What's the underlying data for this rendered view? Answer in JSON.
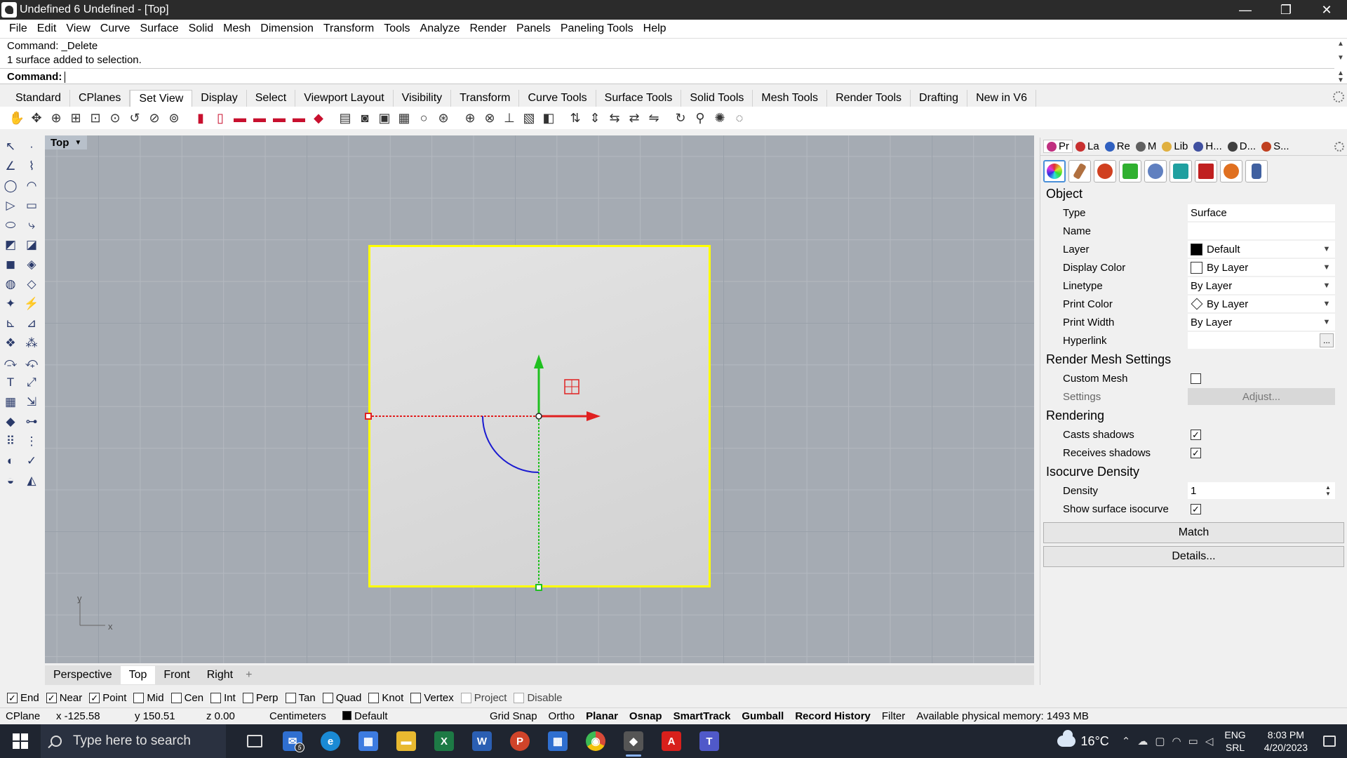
{
  "window": {
    "title": "Undefined 6 Undefined - [Top]",
    "minimize": "—",
    "restore": "❐",
    "close": "✕"
  },
  "menu": [
    "File",
    "Edit",
    "View",
    "Curve",
    "Surface",
    "Solid",
    "Mesh",
    "Dimension",
    "Transform",
    "Tools",
    "Analyze",
    "Render",
    "Panels",
    "Paneling Tools",
    "Help"
  ],
  "command": {
    "history": [
      "Command: _Delete",
      "1 surface added to selection."
    ],
    "prompt_label": "Command:",
    "value": ""
  },
  "toolbar_tabs": {
    "items": [
      "Standard",
      "CPlanes",
      "Set View",
      "Display",
      "Select",
      "Viewport Layout",
      "Visibility",
      "Transform",
      "Curve Tools",
      "Surface Tools",
      "Solid Tools",
      "Mesh Tools",
      "Render Tools",
      "Drafting",
      "New in V6"
    ],
    "active": "Set View"
  },
  "viewport": {
    "name": "Top",
    "axis_x": "x",
    "axis_y": "y",
    "colors": {
      "background": "#a5abb3",
      "selection": "#ffff00",
      "x_axis": "#e02020",
      "y_axis": "#20c020",
      "curve": "#1a1ad0"
    }
  },
  "viewport_tabs": {
    "items": [
      "Perspective",
      "Top",
      "Front",
      "Right"
    ],
    "active": "Top",
    "add": "+"
  },
  "right_panel": {
    "tabs": [
      {
        "label": "Pr",
        "color": "#c03080"
      },
      {
        "label": "La",
        "color": "#c83030"
      },
      {
        "label": "Re",
        "color": "#3060c0"
      },
      {
        "label": "M",
        "color": "#606060"
      },
      {
        "label": "Lib",
        "color": "#e0b040"
      },
      {
        "label": "H...",
        "color": "#4050a0"
      },
      {
        "label": "D...",
        "color": "#404040"
      },
      {
        "label": "S...",
        "color": "#c04020"
      }
    ],
    "icon_colors": [
      "#9040c0",
      "#b07040",
      "#d04020",
      "#30b030",
      "#6080c0",
      "#20a0a0",
      "#c02020",
      "#e07020",
      "#4060a0"
    ],
    "sections": {
      "object": "Object",
      "render_mesh": "Render Mesh Settings",
      "rendering": "Rendering",
      "isocurve": "Isocurve Density"
    },
    "props": {
      "type": {
        "label": "Type",
        "value": "Surface"
      },
      "name": {
        "label": "Name",
        "value": ""
      },
      "layer": {
        "label": "Layer",
        "value": "Default"
      },
      "display_color": {
        "label": "Display Color",
        "value": "By Layer"
      },
      "linetype": {
        "label": "Linetype",
        "value": "By Layer"
      },
      "print_color": {
        "label": "Print Color",
        "value": "By Layer"
      },
      "print_width": {
        "label": "Print Width",
        "value": "By Layer"
      },
      "hyperlink": {
        "label": "Hyperlink",
        "value": "",
        "button": "..."
      },
      "custom_mesh": {
        "label": "Custom Mesh",
        "checked": false
      },
      "settings": {
        "label": "Settings",
        "button": "Adjust..."
      },
      "casts_shadows": {
        "label": "Casts shadows",
        "checked": true
      },
      "receives_shadows": {
        "label": "Receives shadows",
        "checked": true
      },
      "density": {
        "label": "Density",
        "value": "1"
      },
      "show_isocurve": {
        "label": "Show surface isocurve",
        "checked": true
      }
    },
    "match_button": "Match",
    "details_button": "Details..."
  },
  "osnaps": [
    {
      "label": "End",
      "checked": true
    },
    {
      "label": "Near",
      "checked": true
    },
    {
      "label": "Point",
      "checked": true
    },
    {
      "label": "Mid",
      "checked": false
    },
    {
      "label": "Cen",
      "checked": false
    },
    {
      "label": "Int",
      "checked": false
    },
    {
      "label": "Perp",
      "checked": false
    },
    {
      "label": "Tan",
      "checked": false
    },
    {
      "label": "Quad",
      "checked": false
    },
    {
      "label": "Knot",
      "checked": false
    },
    {
      "label": "Vertex",
      "checked": false
    },
    {
      "label": "Project",
      "checked": false,
      "dim": true
    },
    {
      "label": "Disable",
      "checked": false,
      "dim": true
    }
  ],
  "status": {
    "cplane": "CPlane",
    "x": "x -125.58",
    "y": "y 150.51",
    "z": "z 0.00",
    "units": "Centimeters",
    "layer": "Default",
    "toggles": [
      {
        "label": "Grid Snap",
        "bold": false
      },
      {
        "label": "Ortho",
        "bold": false
      },
      {
        "label": "Planar",
        "bold": true
      },
      {
        "label": "Osnap",
        "bold": true
      },
      {
        "label": "SmartTrack",
        "bold": true
      },
      {
        "label": "Gumball",
        "bold": true
      },
      {
        "label": "Record History",
        "bold": true
      },
      {
        "label": "Filter",
        "bold": false
      }
    ],
    "memory": "Available physical memory: 1493 MB"
  },
  "taskbar": {
    "search_placeholder": "Type here to search",
    "apps": [
      {
        "name": "task-view",
        "label": "",
        "color": "#3a4250"
      },
      {
        "name": "mail",
        "label": "✉",
        "color": "#2f6fd0",
        "badge": "5"
      },
      {
        "name": "edge",
        "label": "e",
        "color": "#1a8ad4"
      },
      {
        "name": "store",
        "label": "▦",
        "color": "#3d7be0"
      },
      {
        "name": "file-explorer",
        "label": "▬",
        "color": "#e8b930"
      },
      {
        "name": "excel",
        "label": "X",
        "color": "#1d7a45"
      },
      {
        "name": "word",
        "label": "W",
        "color": "#2b5fb3"
      },
      {
        "name": "powerpoint",
        "label": "P",
        "color": "#d0442a"
      },
      {
        "name": "calendar",
        "label": "▦",
        "color": "#2f6fd0"
      },
      {
        "name": "chrome",
        "label": "◉",
        "color": "#d84a38"
      },
      {
        "name": "rhino",
        "label": "◆",
        "color": "#555555"
      },
      {
        "name": "acrobat",
        "label": "A",
        "color": "#d8201c"
      },
      {
        "name": "teams",
        "label": "T",
        "color": "#5059c9"
      }
    ],
    "weather": "16°C",
    "lang_top": "ENG",
    "lang_bottom": "SRL",
    "time": "8:03 PM",
    "date": "4/20/2023"
  }
}
